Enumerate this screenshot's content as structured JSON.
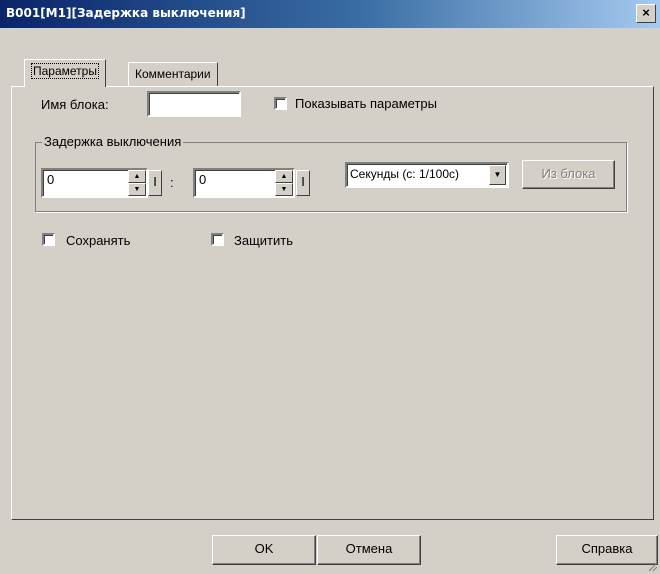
{
  "window": {
    "title": "B001[M1][Задержка выключения]",
    "close_glyph": "×"
  },
  "tabs": [
    {
      "label": "Параметры",
      "active": true
    },
    {
      "label": "Комментарии",
      "active": false
    }
  ],
  "params": {
    "block_name_label": "Имя блока:",
    "block_name_value": "",
    "show_params_label": "Показывать параметры",
    "show_params_checked": false
  },
  "delay_group": {
    "legend": "Задержка выключения",
    "value1": "0",
    "value2": "0",
    "separator": ":",
    "i_button_label": "I",
    "units_selected": "Секунды (с: 1/100с)",
    "from_block_label": "Из блока"
  },
  "options": {
    "retain_label": "Сохранять",
    "retain_checked": false,
    "protect_label": "Защитить",
    "protect_checked": false
  },
  "footer": {
    "ok_label": "OK",
    "cancel_label": "Отмена",
    "help_label": "Справка"
  }
}
